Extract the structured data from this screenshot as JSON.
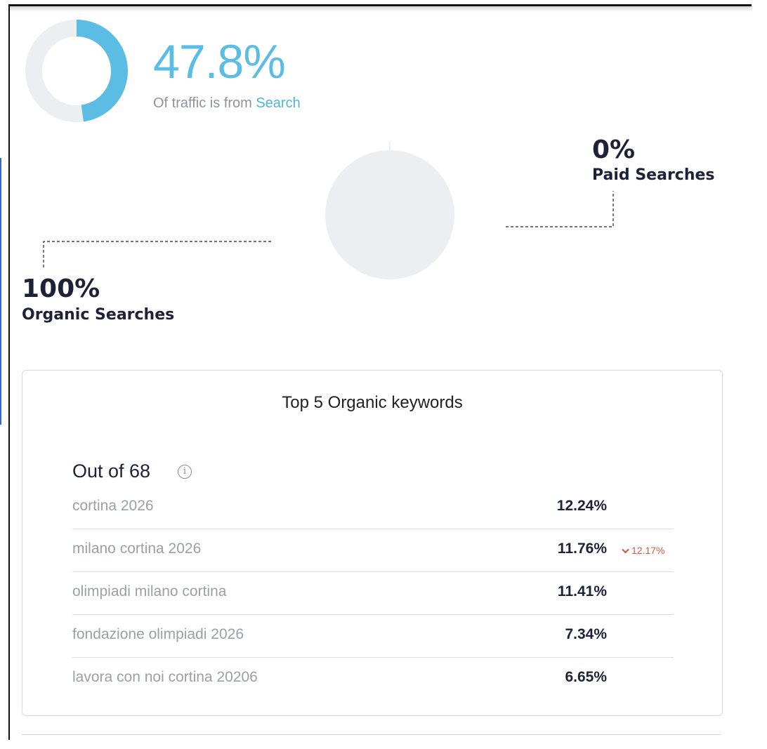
{
  "traffic": {
    "percent": "47.8%",
    "percent_value": 47.8,
    "caption_prefix": "Of traffic is from",
    "caption_highlight": "Search",
    "accent_color": "#5bbde3",
    "track_color": "#edeef2"
  },
  "split": {
    "paid": {
      "percent": "0%",
      "label": "Paid Searches",
      "value": 0
    },
    "organic": {
      "percent": "100%",
      "label": "Organic Searches",
      "value": 100
    },
    "pie_color": "#edeef2"
  },
  "keywords_card": {
    "title": "Top 5 Organic keywords",
    "out_of": "Out of 68",
    "info_icon": "info-icon",
    "rows": [
      {
        "keyword": "cortina 2026",
        "share": "12.24%",
        "delta": ""
      },
      {
        "keyword": "milano cortina 2026",
        "share": "11.76%",
        "delta": "12.17%"
      },
      {
        "keyword": "olimpiadi milano cortina",
        "share": "11.41%",
        "delta": ""
      },
      {
        "keyword": "fondazione olimpiadi 2026",
        "share": "7.34%",
        "delta": ""
      },
      {
        "keyword": "lavora con noi cortina 20206",
        "share": "6.65%",
        "delta": ""
      }
    ],
    "delta_color": "#d75a40",
    "delta_icon": "chevron-down-icon"
  }
}
